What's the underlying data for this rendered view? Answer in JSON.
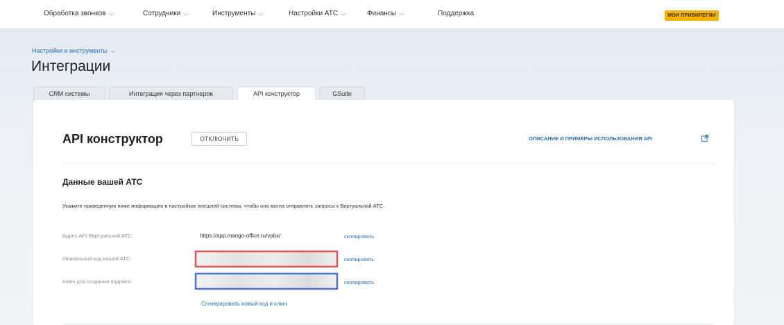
{
  "nav": {
    "items": [
      {
        "label": "Обработка звонков",
        "has_dropdown": true
      },
      {
        "label": "Сотрудники",
        "has_dropdown": true
      },
      {
        "label": "Инструменты",
        "has_dropdown": true
      },
      {
        "label": "Настройки АТС",
        "has_dropdown": true
      },
      {
        "label": "Финансы",
        "has_dropdown": true
      },
      {
        "label": "Поддержка",
        "has_dropdown": false
      }
    ],
    "privileges_label": "МОИ ПРИВИЛЕГИИ",
    "chevron_glyph": "⌵"
  },
  "breadcrumb": "Настройки и инструменты →",
  "page_title": "Интеграции",
  "tabs": [
    {
      "label": "CRM системы",
      "active": false
    },
    {
      "label": "Интеграция через партнеров",
      "active": false
    },
    {
      "label": "API конструктор",
      "active": true
    },
    {
      "label": "GSuite",
      "active": false
    }
  ],
  "card": {
    "title": "API конструктор",
    "disable_label": "отключить",
    "api_docs_link": "ОПИСАНИЕ И ПРИМЕРЫ ИСПОЛЬЗОВАНИЯ API",
    "section_title": "Данные вашей АТС",
    "description": "Укажите приведенную ниже информацию в настройках внешней системы, чтобы она могла отправлять запросы к Виртуальной АТС.",
    "rows": [
      {
        "label": "Адрес API Виртуальной АТС:",
        "value": "https://app.mango-office.ru/vpbx/",
        "copy_label": "скопировать",
        "masked": false
      },
      {
        "label": "Уникальный код вашей АТС:",
        "value": "",
        "copy_label": "скопировать",
        "masked": true,
        "highlight": "red"
      },
      {
        "label": "Ключ для создания подписи:",
        "value": "",
        "copy_label": "скопировать",
        "masked": true,
        "highlight": "blue"
      }
    ],
    "generate_link": "Сгенерировать новый код и ключ"
  },
  "colors": {
    "accent": "#2a6db5",
    "privileges": "#f5b400",
    "highlight_red": "#e32626",
    "highlight_blue": "#1f4fd8"
  },
  "icons": {
    "external_link": "external-link-icon",
    "chevron": "chevron-down-icon"
  }
}
